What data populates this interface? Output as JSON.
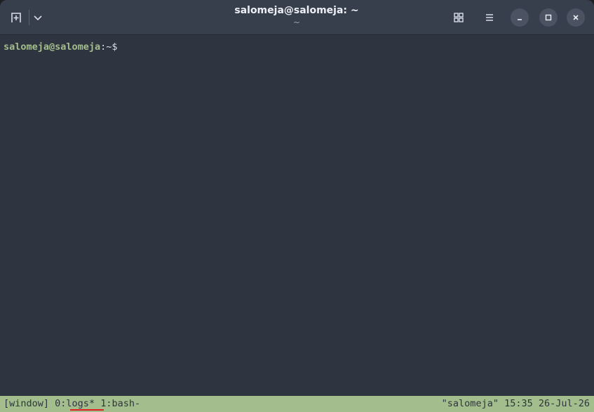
{
  "window": {
    "title": "salomeja@salomeja: ~",
    "subtitle": "~"
  },
  "icons": {
    "new_tab": "new-tab-icon",
    "menu_chevron": "chevron-down-icon",
    "grid": "grid-icon",
    "hamburger": "hamburger-menu-icon",
    "minimize": "minimize-icon",
    "maximize": "maximize-icon",
    "close": "close-icon"
  },
  "terminal": {
    "prompt_user_host": "salomeja@salomeja",
    "prompt_path": ":~$"
  },
  "tmux": {
    "session_label": "[window]",
    "windows": [
      {
        "label": "0:logs*"
      },
      {
        "label": "1:bash-"
      }
    ],
    "right_status": "\"salomeja\" 15:35 26-Jul-26"
  },
  "colors": {
    "terminal_bg": "#2e3440",
    "titlebar_bg": "#373e4c",
    "status_bg": "#a3be8c",
    "prompt_green": "#a3be8c",
    "annotation_red": "#e02020"
  }
}
